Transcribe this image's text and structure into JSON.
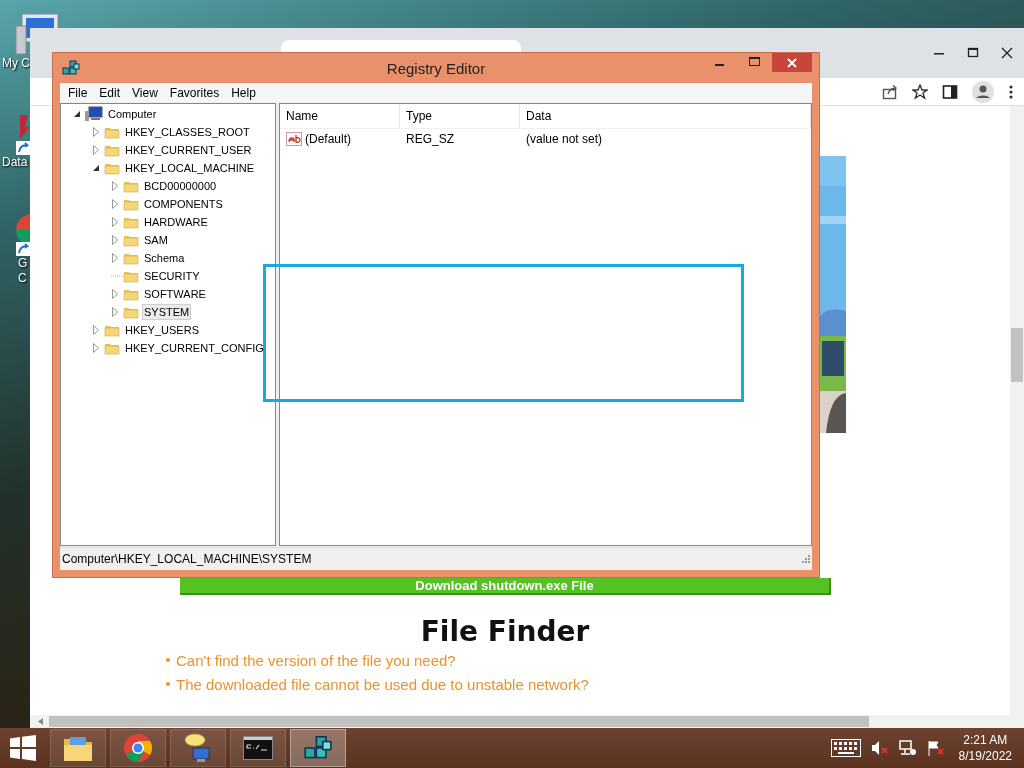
{
  "desktop": {
    "icons": [
      {
        "kind": "computer",
        "lines": [
          "My C"
        ]
      },
      {
        "kind": "app-shortcut",
        "lines": [
          "Data"
        ]
      },
      {
        "kind": "chrome-shortcut",
        "lines": [
          "G",
          "C"
        ]
      }
    ]
  },
  "browser": {
    "page": {
      "download_button": "Download shutdown.exe File",
      "heading": "File Finder",
      "bullets": [
        "Can't find the version of the file you need?",
        "The downloaded file cannot be used due to unstable network?"
      ]
    }
  },
  "registry_editor": {
    "title": "Registry Editor",
    "menu": [
      "File",
      "Edit",
      "View",
      "Favorites",
      "Help"
    ],
    "tree": [
      {
        "label": "Computer",
        "kind": "computer",
        "expandable": true,
        "expanded": true,
        "selected": false,
        "children": [
          {
            "label": "HKEY_CLASSES_ROOT",
            "kind": "folder",
            "expandable": true,
            "expanded": false,
            "selected": false
          },
          {
            "label": "HKEY_CURRENT_USER",
            "kind": "folder",
            "expandable": true,
            "expanded": false,
            "selected": false
          },
          {
            "label": "HKEY_LOCAL_MACHINE",
            "kind": "folder",
            "expandable": true,
            "expanded": true,
            "selected": false,
            "children": [
              {
                "label": "BCD00000000",
                "kind": "folder",
                "expandable": true,
                "expanded": false,
                "selected": false
              },
              {
                "label": "COMPONENTS",
                "kind": "folder",
                "expandable": true,
                "expanded": false,
                "selected": false
              },
              {
                "label": "HARDWARE",
                "kind": "folder",
                "expandable": true,
                "expanded": false,
                "selected": false
              },
              {
                "label": "SAM",
                "kind": "folder",
                "expandable": true,
                "expanded": false,
                "selected": false
              },
              {
                "label": "Schema",
                "kind": "folder",
                "expandable": true,
                "expanded": false,
                "selected": false
              },
              {
                "label": "SECURITY",
                "kind": "folder",
                "expandable": false,
                "expanded": false,
                "selected": false
              },
              {
                "label": "SOFTWARE",
                "kind": "folder",
                "expandable": true,
                "expanded": false,
                "selected": false
              },
              {
                "label": "SYSTEM",
                "kind": "folder",
                "expandable": true,
                "expanded": false,
                "selected": true
              }
            ]
          },
          {
            "label": "HKEY_USERS",
            "kind": "folder",
            "expandable": true,
            "expanded": false,
            "selected": false
          },
          {
            "label": "HKEY_CURRENT_CONFIG",
            "kind": "folder",
            "expandable": true,
            "expanded": false,
            "selected": false
          }
        ]
      }
    ],
    "columns": [
      "Name",
      "Type",
      "Data"
    ],
    "rows": [
      {
        "name": "(Default)",
        "type": "REG_SZ",
        "data": "(value not set)"
      }
    ],
    "status_bar": "Computer\\HKEY_LOCAL_MACHINE\\SYSTEM"
  },
  "taskbar": {
    "apps": [
      {
        "kind": "explorer",
        "selected": false
      },
      {
        "kind": "chrome",
        "selected": false
      },
      {
        "kind": "network",
        "selected": false
      },
      {
        "kind": "cmd",
        "selected": false
      },
      {
        "kind": "regedit",
        "selected": true
      }
    ],
    "time": "2:21 AM",
    "date": "8/19/2022"
  }
}
